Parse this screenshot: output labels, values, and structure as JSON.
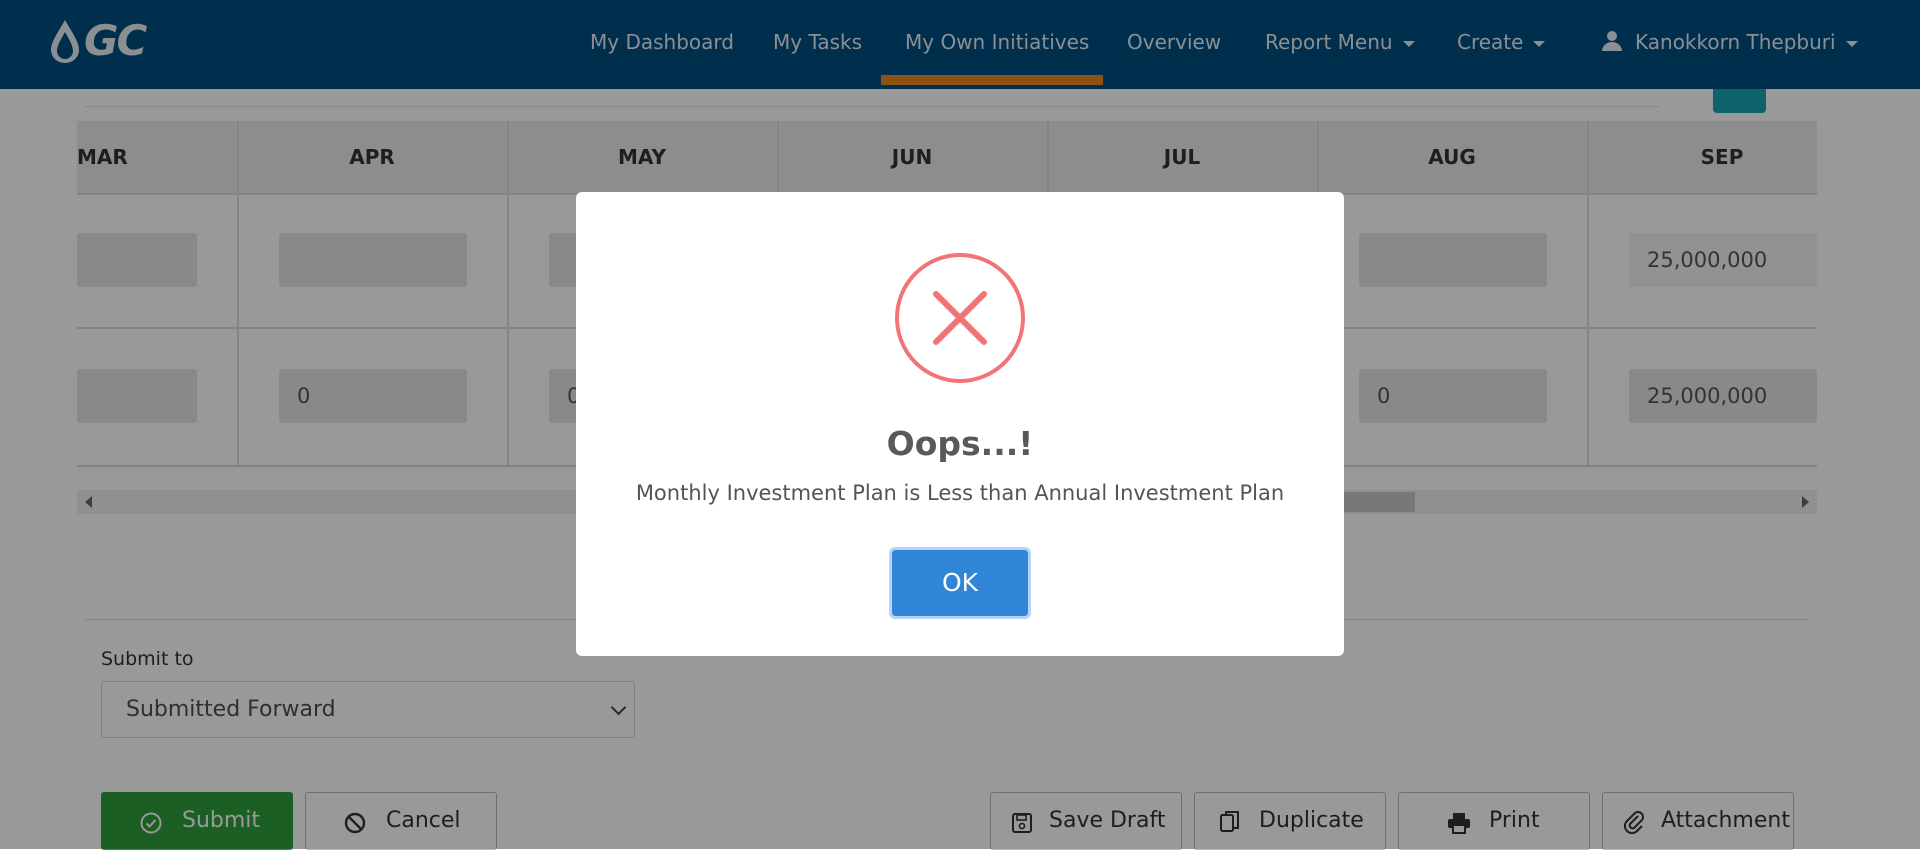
{
  "navbar": {
    "logo_text": "GC",
    "items": [
      {
        "label": "My Dashboard"
      },
      {
        "label": "My Tasks"
      },
      {
        "label": "My Own Initiatives"
      },
      {
        "label": "Overview"
      },
      {
        "label": "Report Menu"
      },
      {
        "label": "Create"
      }
    ],
    "active_item": "My Own Initiatives",
    "user_name": "Kanokkorn Thepburi",
    "colors": {
      "background": "#004d80",
      "active_indicator": "#e98a1c"
    }
  },
  "grid": {
    "columns": [
      "MAR",
      "APR",
      "MAY",
      "JUN",
      "JUL",
      "AUG",
      "SEP"
    ],
    "row1": {
      "sep_value": "25,000,000"
    },
    "row2": {
      "apr_value": "0",
      "may_value": "0",
      "aug_value": "0",
      "sep_value": "25,000,000"
    }
  },
  "form": {
    "submit_to_label": "Submit to",
    "submit_to_value": "Submitted Forward"
  },
  "actions": {
    "submit": "Submit",
    "cancel": "Cancel",
    "save_draft": "Save Draft",
    "duplicate": "Duplicate",
    "print": "Print",
    "attachment": "Attachment",
    "submit_color": "#2e9e3c"
  },
  "modal": {
    "icon": "error-x-icon",
    "title": "Oops...!",
    "message": "Monthly Investment Plan is Less than Annual Investment Plan",
    "ok_label": "OK",
    "ok_color": "#3085d6",
    "icon_color": "#f27474"
  }
}
